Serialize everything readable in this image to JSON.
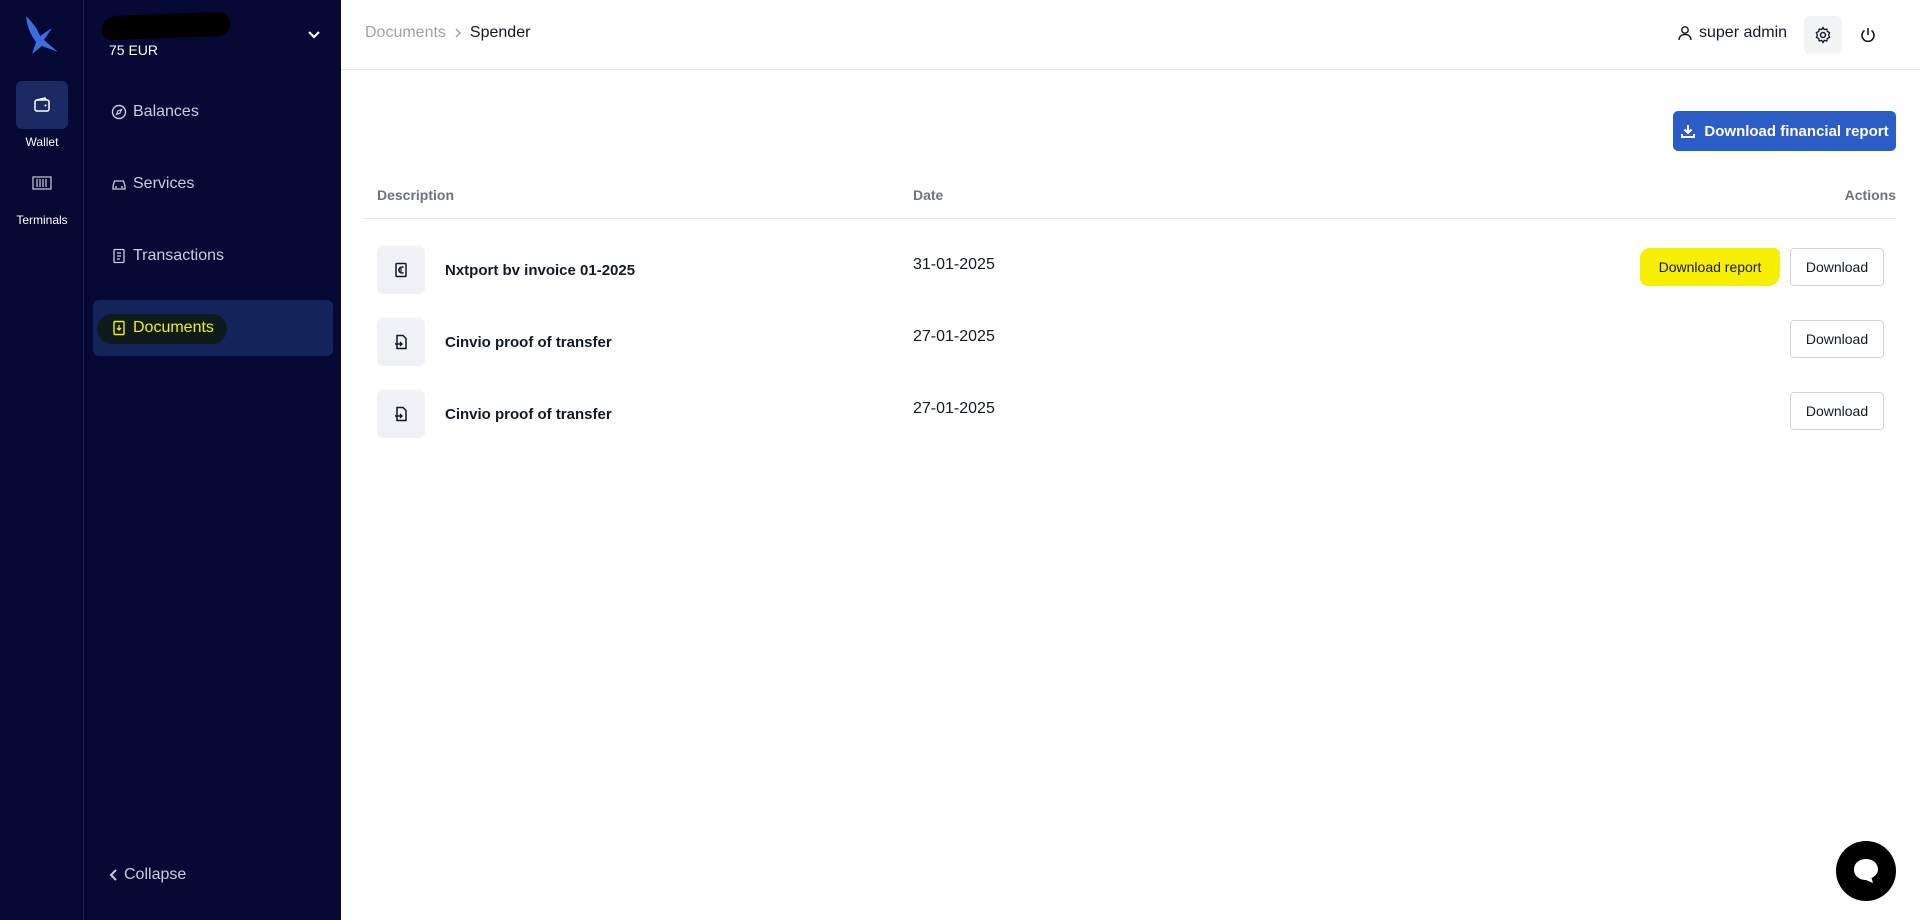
{
  "rail": {
    "items": [
      {
        "label": "Wallet",
        "icon": "wallet-icon",
        "active": true
      },
      {
        "label": "Terminals",
        "icon": "terminal-icon",
        "active": false
      }
    ]
  },
  "account": {
    "balance": "75 EUR"
  },
  "sidebar": {
    "items": [
      {
        "label": "Balances",
        "icon": "compass-icon"
      },
      {
        "label": "Services",
        "icon": "car-icon"
      },
      {
        "label": "Transactions",
        "icon": "receipt-icon"
      },
      {
        "label": "Documents",
        "icon": "document-icon",
        "active": true
      }
    ],
    "collapse_label": "Collapse"
  },
  "header": {
    "breadcrumb": [
      "Documents",
      "Spender"
    ],
    "user_name": "super admin"
  },
  "main": {
    "primary_button": "Download financial report",
    "columns": [
      "Description",
      "Date",
      "Actions"
    ],
    "rows": [
      {
        "description": "Nxtport bv invoice 01-2025",
        "date": "31-01-2025",
        "report_label": "Download report",
        "download_label": "Download",
        "icon": "euro-document-icon"
      },
      {
        "description": "Cinvio proof of transfer",
        "date": "27-01-2025",
        "download_label": "Download",
        "icon": "file-transfer-icon"
      },
      {
        "description": "Cinvio proof of transfer",
        "date": "27-01-2025",
        "download_label": "Download",
        "icon": "file-transfer-icon"
      }
    ]
  },
  "colors": {
    "sidebar_bg": "#050933",
    "active_bg": "#14245a",
    "highlight": "#f6f000",
    "primary": "#2c5cc5"
  }
}
